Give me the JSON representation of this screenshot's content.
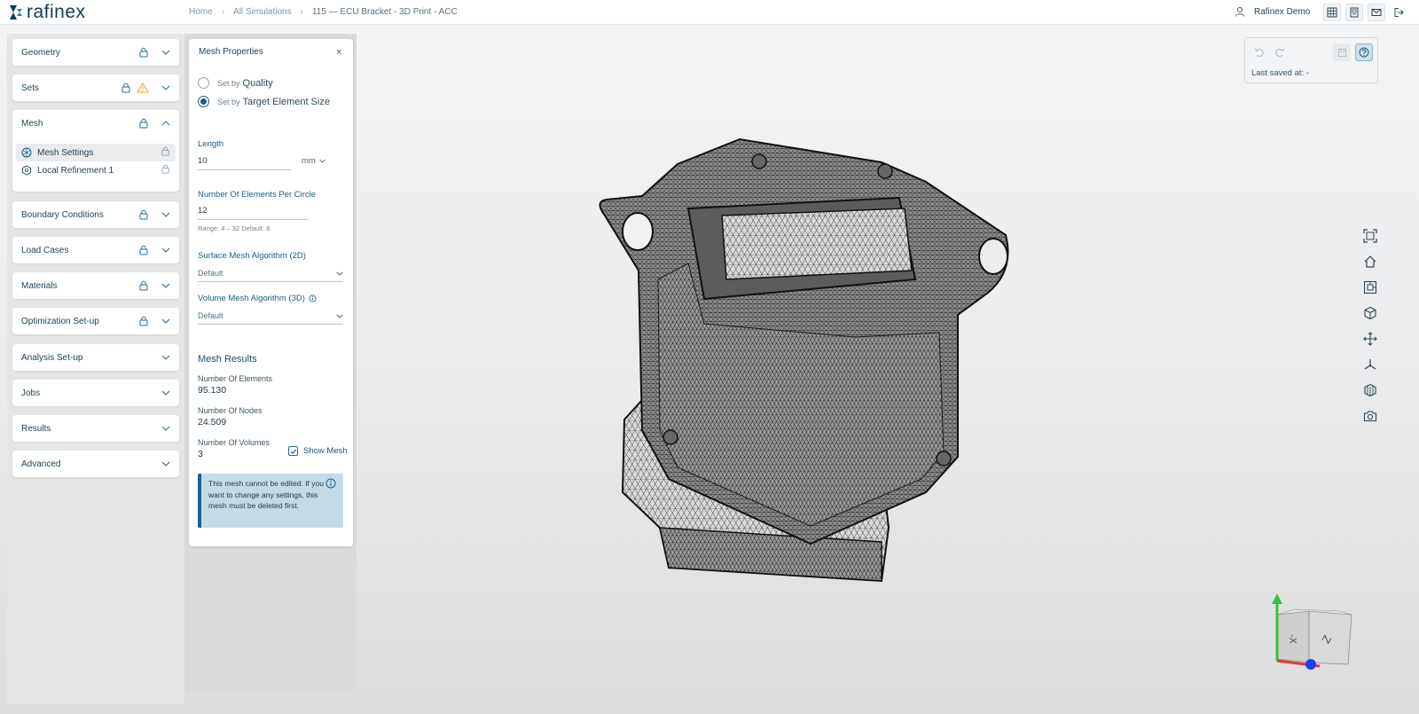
{
  "app": {
    "brand": "rafinex"
  },
  "breadcrumb": [
    {
      "label": "Home"
    },
    {
      "label": "All Simulations"
    },
    {
      "label": "115 — ECU Bracket - 3D Print - ACC"
    }
  ],
  "user": {
    "name": "Rafinex Demo"
  },
  "top_icons": [
    "table-icon",
    "document-icon",
    "mail-icon",
    "logout-icon"
  ],
  "sidebar": {
    "sections": [
      {
        "label": "Geometry"
      },
      {
        "label": "Sets"
      },
      {
        "label": "Mesh",
        "items": [
          {
            "label": "Mesh Settings"
          },
          {
            "label": "Local Refinement 1"
          }
        ]
      },
      {
        "label": "Boundary Conditions"
      },
      {
        "label": "Load Cases"
      },
      {
        "label": "Materials"
      },
      {
        "label": "Optimization Set-up"
      },
      {
        "label": "Analysis Set-up"
      },
      {
        "label": "Jobs"
      },
      {
        "label": "Results"
      },
      {
        "label": "Advanced"
      }
    ]
  },
  "mesh_panel": {
    "title": "Mesh Properties",
    "close": "×",
    "radio_quality": {
      "prefix": "Set by",
      "label": "Quality",
      "selected": false
    },
    "radio_size": {
      "prefix": "Set by",
      "label": "Target Element Size",
      "selected": true
    },
    "length": {
      "label": "Length",
      "value": "10",
      "unit": "mm"
    },
    "elements_per_circle": {
      "label": "Number Of Elements Per Circle",
      "value": "12",
      "hint": "Range: 4 – 32  Default: 8"
    },
    "surface_algorithm": {
      "label": "Surface Mesh Algorithm (2D)",
      "value": "Default"
    },
    "volume_algorithm": {
      "label": "Volume Mesh Algorithm (3D)",
      "value": "Default"
    },
    "results": {
      "title": "Mesh Results",
      "elements": {
        "label": "Number Of Elements",
        "value": "95.130"
      },
      "nodes": {
        "label": "Number Of Nodes",
        "value": "24.509"
      },
      "volumes": {
        "label": "Number Of Volumes",
        "value": "3"
      },
      "show_mesh": {
        "label": "Show Mesh",
        "checked": true
      }
    },
    "info": "This mesh cannot be edited. If you want to change any settings, this mesh must be deleted first."
  },
  "save_box": {
    "last_saved": "Last saved at: -"
  },
  "view_tools": [
    "fit-view-icon",
    "home-view-icon",
    "zoom-box-icon",
    "cube-view-icon",
    "pan-icon",
    "axes-icon",
    "section-view-icon",
    "camera-icon"
  ],
  "gizmo": {
    "face_left": "-X",
    "face_right": "Z"
  },
  "colors": {
    "accent": "#1d5e83",
    "info_bg": "#c4dae4",
    "axis_y": "#2fc43a",
    "axis_z": "#1f3fff",
    "axis_x": "#e53935"
  }
}
